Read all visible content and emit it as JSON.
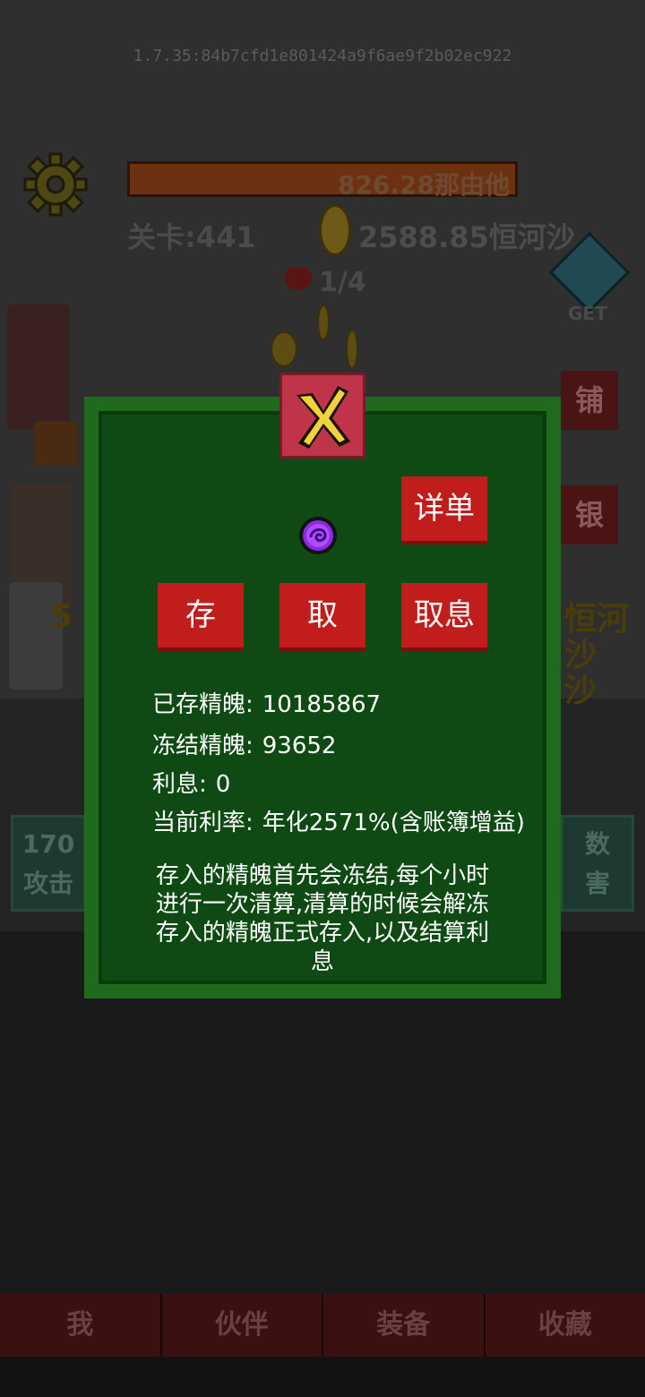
{
  "version_hash": "1.7.35:84b7cfd1e801424a9f6ae9f2b02ec922",
  "header": {
    "hp_value": "826.28那由他",
    "level_label": "关卡:441",
    "gold_amount": "2588.85恒河沙",
    "wave_progress": "1/4",
    "gem_label": "GET"
  },
  "side_buttons": [
    "铺",
    "银"
  ],
  "background_fragments": {
    "left_stat": [
      "170",
      "攻击"
    ],
    "right_stat": [
      "数",
      "害"
    ],
    "right_yellow": [
      "恒河沙",
      "沙"
    ],
    "left_yellow": "5"
  },
  "bank_modal": {
    "detail_button": "详单",
    "deposit_button": "存",
    "withdraw_button": "取",
    "withdraw_interest_button": "取息",
    "stats": [
      {
        "label": "已存精魄:",
        "value": "10185867"
      },
      {
        "label": "冻结精魄:",
        "value": "93652"
      },
      {
        "label": "利息:",
        "value": "0"
      },
      {
        "label": "当前利率:",
        "value": "年化2571%(含账簿增益)"
      }
    ],
    "description_lines": [
      "存入的精魄首先会冻结,每个小时",
      "进行一次清算,清算的时候会解冻",
      "存入的精魄正式存入,以及结算利",
      "息"
    ]
  },
  "bottom_nav": [
    "我",
    "伙伴",
    "装备",
    "收藏"
  ],
  "colors": {
    "modal_border": "#1f6a1f",
    "modal_fill": "#0f4a14",
    "button_red": "#c21d1d",
    "close_pink": "#c0344a",
    "close_x": "#f2d23a"
  }
}
